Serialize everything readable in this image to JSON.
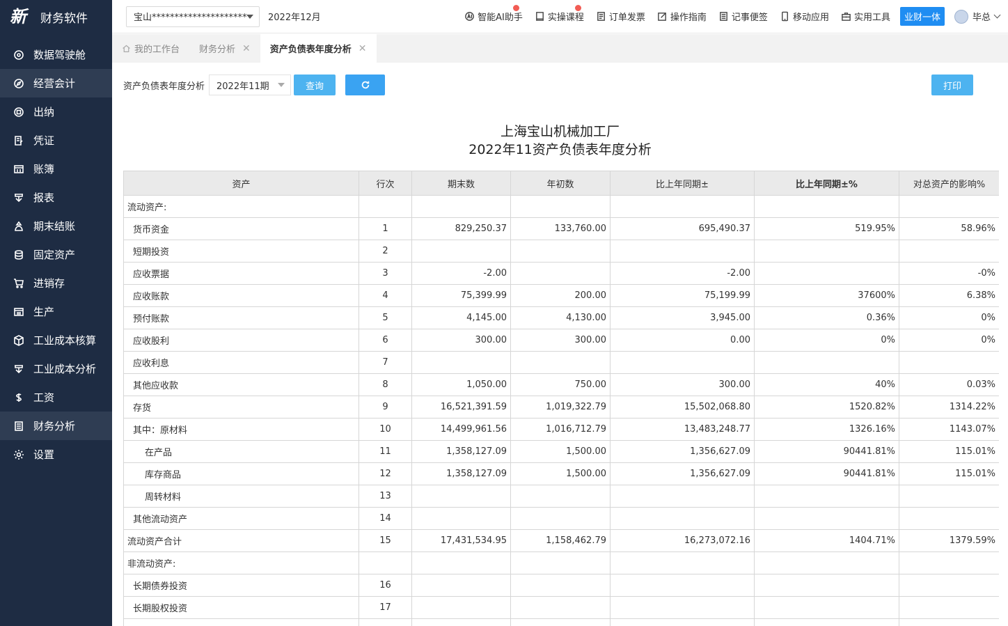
{
  "brand": {
    "logo_text": "新",
    "name": "财务软件"
  },
  "sidebar": {
    "items": [
      {
        "label": "数据驾驶舱",
        "icon": "dashboard-icon"
      },
      {
        "label": "经营会计",
        "icon": "compass-icon"
      },
      {
        "label": "出纳",
        "icon": "cashier-icon"
      },
      {
        "label": "凭证",
        "icon": "voucher-icon"
      },
      {
        "label": "账簿",
        "icon": "ledger-icon"
      },
      {
        "label": "报表",
        "icon": "report-icon"
      },
      {
        "label": "期末结账",
        "icon": "closing-icon"
      },
      {
        "label": "固定资产",
        "icon": "database-icon"
      },
      {
        "label": "进销存",
        "icon": "cart-icon"
      },
      {
        "label": "生产",
        "icon": "production-icon"
      },
      {
        "label": "工业成本核算",
        "icon": "cube-icon"
      },
      {
        "label": "工业成本分析",
        "icon": "analysis-icon"
      },
      {
        "label": "工资",
        "icon": "dollar-icon"
      },
      {
        "label": "财务分析",
        "icon": "finance-icon"
      },
      {
        "label": "设置",
        "icon": "gear-icon"
      }
    ],
    "active_index": 13,
    "hover_index": 1
  },
  "topbar": {
    "company": "宝山**********************",
    "period": "2022年12月",
    "actions": [
      {
        "label": "智能AI助手",
        "icon": "ai-icon",
        "hot": true
      },
      {
        "label": "实操课程",
        "icon": "course-icon",
        "hot": true
      },
      {
        "label": "订单发票",
        "icon": "invoice-icon",
        "hot": false
      },
      {
        "label": "操作指南",
        "icon": "guide-icon",
        "hot": false
      },
      {
        "label": "记事便签",
        "icon": "note-icon",
        "hot": false
      },
      {
        "label": "移动应用",
        "icon": "mobile-icon",
        "hot": false
      },
      {
        "label": "实用工具",
        "icon": "toolbox-icon",
        "hot": false
      }
    ],
    "yecai": "业财一体",
    "user": "毕总"
  },
  "tabs": [
    {
      "label": "我的工作台",
      "closable": false,
      "active": false
    },
    {
      "label": "财务分析",
      "closable": true,
      "active": false
    },
    {
      "label": "资产负债表年度分析",
      "closable": true,
      "active": true
    }
  ],
  "toolbar": {
    "label": "资产负债表年度分析",
    "period_value": "2022年11期",
    "query_label": "查询",
    "print_label": "打印"
  },
  "report": {
    "company": "上海宝山机械加工厂",
    "title": "2022年11资产负债表年度分析"
  },
  "table": {
    "headers": [
      "资产",
      "行次",
      "期末数",
      "年初数",
      "比上年同期±",
      "比上年同期±%",
      "对总资产的影响%"
    ],
    "rows": [
      {
        "name": "流动资产:",
        "indent": 0,
        "row": "",
        "end": "",
        "begin": "",
        "diff": "",
        "pct": "",
        "impact": ""
      },
      {
        "name": "货币资金",
        "indent": 1,
        "row": "1",
        "end": "829,250.37",
        "begin": "133,760.00",
        "diff": "695,490.37",
        "pct": "519.95%",
        "impact": "58.96%"
      },
      {
        "name": "短期投资",
        "indent": 1,
        "row": "2",
        "end": "",
        "begin": "",
        "diff": "",
        "pct": "",
        "impact": ""
      },
      {
        "name": "应收票据",
        "indent": 1,
        "row": "3",
        "end": "-2.00",
        "begin": "",
        "diff": "-2.00",
        "pct": "",
        "impact": "-0%"
      },
      {
        "name": "应收账款",
        "indent": 1,
        "row": "4",
        "end": "75,399.99",
        "begin": "200.00",
        "diff": "75,199.99",
        "pct": "37600%",
        "impact": "6.38%"
      },
      {
        "name": "预付账款",
        "indent": 1,
        "row": "5",
        "end": "4,145.00",
        "begin": "4,130.00",
        "diff": "3,945.00",
        "pct": "0.36%",
        "impact": "0%"
      },
      {
        "name": "应收股利",
        "indent": 1,
        "row": "6",
        "end": "300.00",
        "begin": "300.00",
        "diff": "0.00",
        "pct": "0%",
        "impact": "0%"
      },
      {
        "name": "应收利息",
        "indent": 1,
        "row": "7",
        "end": "",
        "begin": "",
        "diff": "",
        "pct": "",
        "impact": ""
      },
      {
        "name": "其他应收款",
        "indent": 1,
        "row": "8",
        "end": "1,050.00",
        "begin": "750.00",
        "diff": "300.00",
        "pct": "40%",
        "impact": "0.03%"
      },
      {
        "name": "存货",
        "indent": 1,
        "row": "9",
        "end": "16,521,391.59",
        "begin": "1,019,322.79",
        "diff": "15,502,068.80",
        "pct": "1520.82%",
        "impact": "1314.22%"
      },
      {
        "name": "其中：原材料",
        "indent": 1,
        "row": "10",
        "end": "14,499,961.56",
        "begin": "1,016,712.79",
        "diff": "13,483,248.77",
        "pct": "1326.16%",
        "impact": "1143.07%"
      },
      {
        "name": "在产品",
        "indent": 2,
        "row": "11",
        "end": "1,358,127.09",
        "begin": "1,500.00",
        "diff": "1,356,627.09",
        "pct": "90441.81%",
        "impact": "115.01%"
      },
      {
        "name": "库存商品",
        "indent": 2,
        "row": "12",
        "end": "1,358,127.09",
        "begin": "1,500.00",
        "diff": "1,356,627.09",
        "pct": "90441.81%",
        "impact": "115.01%"
      },
      {
        "name": "周转材料",
        "indent": 2,
        "row": "13",
        "end": "",
        "begin": "",
        "diff": "",
        "pct": "",
        "impact": ""
      },
      {
        "name": "其他流动资产",
        "indent": 1,
        "row": "14",
        "end": "",
        "begin": "",
        "diff": "",
        "pct": "",
        "impact": ""
      },
      {
        "name": "流动资产合计",
        "indent": 0,
        "row": "15",
        "end": "17,431,534.95",
        "begin": "1,158,462.79",
        "diff": "16,273,072.16",
        "pct": "1404.71%",
        "impact": "1379.59%"
      },
      {
        "name": "非流动资产:",
        "indent": 0,
        "row": "",
        "end": "",
        "begin": "",
        "diff": "",
        "pct": "",
        "impact": ""
      },
      {
        "name": "长期债券投资",
        "indent": 1,
        "row": "16",
        "end": "",
        "begin": "",
        "diff": "",
        "pct": "",
        "impact": ""
      },
      {
        "name": "长期股权投资",
        "indent": 1,
        "row": "17",
        "end": "",
        "begin": "",
        "diff": "",
        "pct": "",
        "impact": ""
      },
      {
        "name": "",
        "indent": 1,
        "row": "",
        "end": "",
        "begin": "",
        "diff": "",
        "pct": "",
        "impact": ""
      }
    ]
  }
}
